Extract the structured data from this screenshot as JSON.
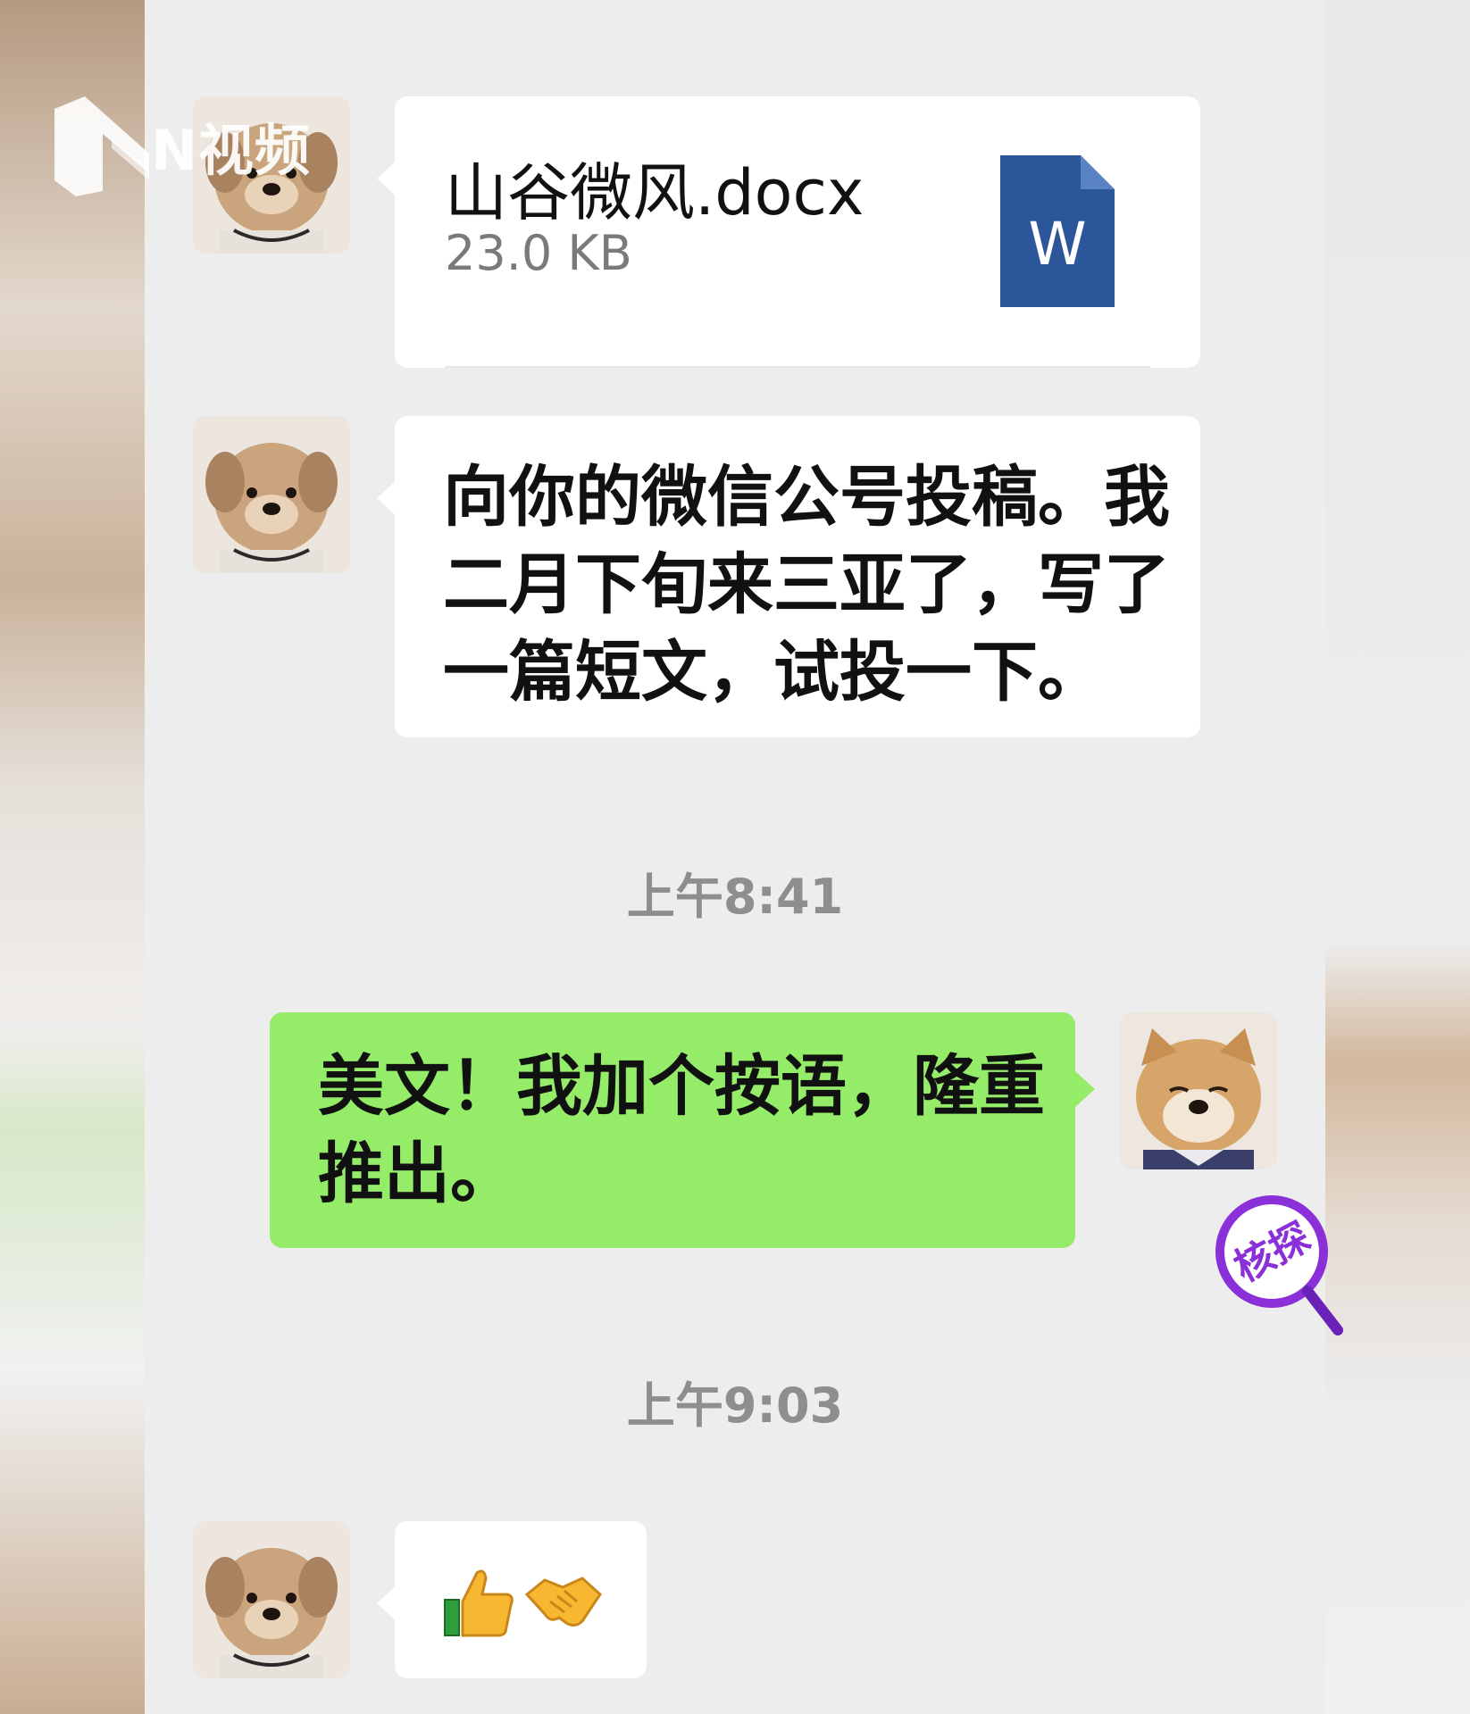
{
  "watermark": {
    "brand_text": "N视频"
  },
  "messages": {
    "file": {
      "name": "山谷微风.docx",
      "size": "23.0 KB",
      "icon_letter": "W",
      "icon_color": "#2b579a"
    },
    "intro": {
      "text": "向你的微信公号投稿。我\n二月下旬来三亚了，写了\n一篇短文，试投一下。"
    },
    "time1": "上午8:41",
    "reply": {
      "text": "美文！我加个按语，隆重\n推出。"
    },
    "time2": "上午9:03",
    "emoji": {
      "thumbs": "👍",
      "handshake": "🤝"
    }
  },
  "stamp": {
    "label": "核探",
    "color": "#8b2fd8"
  },
  "colors": {
    "chat_bg": "#ededed",
    "green_bubble": "#95ec69",
    "white_bubble": "#ffffff"
  },
  "icons": [
    "logo-mark-icon",
    "word-file-icon",
    "dog-avatar",
    "shiba-avatar",
    "magnifier-stamp-icon"
  ]
}
